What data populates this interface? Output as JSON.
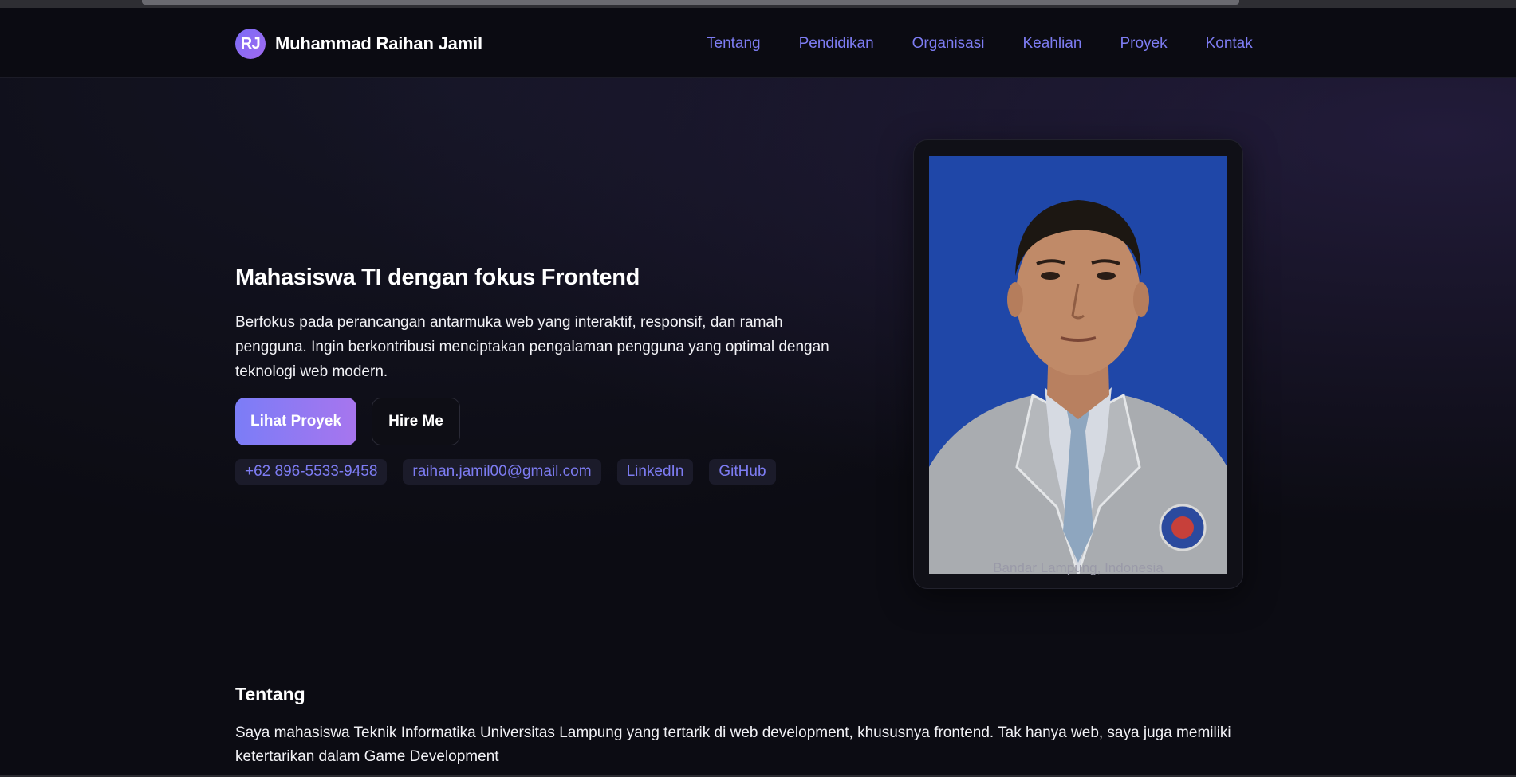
{
  "header": {
    "avatar_initials": "RJ",
    "name": "Muhammad Raihan Jamil",
    "nav": [
      "Tentang",
      "Pendidikan",
      "Organisasi",
      "Keahlian",
      "Proyek",
      "Kontak"
    ]
  },
  "hero": {
    "title": "Mahasiswa TI dengan fokus Frontend",
    "description": "Berfokus pada perancangan antarmuka web yang interaktif, responsif, dan ramah pengguna. Ingin berkontribusi menciptakan pengalaman pengguna yang optimal dengan teknologi web modern.",
    "primary_button": "Lihat Proyek",
    "secondary_button": "Hire Me",
    "contacts": [
      "+62 896-5533-9458",
      "raihan.jamil00@gmail.com",
      "LinkedIn",
      "GitHub"
    ],
    "photo_caption": "Bandar Lampung, Indonesia"
  },
  "about": {
    "title": "Tentang",
    "text": "Saya mahasiswa Teknik Informatika Universitas Lampung yang tertarik di web development, khususnya frontend. Tak hanya web, saya juga memiliki ketertarikan dalam Game Development"
  },
  "colors": {
    "background": "#0c0c13",
    "accent": "#7d7cf2",
    "accent_gradient_end": "#a775ee",
    "photo_background": "#1f47a8"
  }
}
